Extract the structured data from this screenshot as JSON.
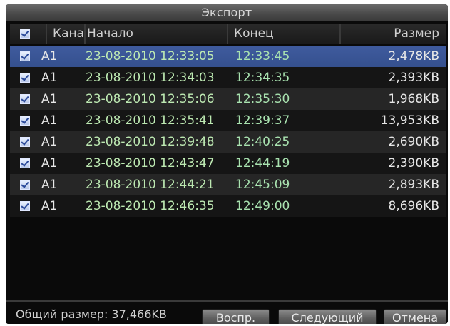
{
  "window": {
    "title": "Экспорт"
  },
  "table": {
    "headers": {
      "channel": "Канал",
      "start": "Начало",
      "end": "Конец",
      "size": "Размер"
    },
    "rows": [
      {
        "checked": true,
        "channel": "A1",
        "start": "23-08-2010 12:33:05",
        "end": "12:33:45",
        "size": "2,478KB",
        "selected": true
      },
      {
        "checked": true,
        "channel": "A1",
        "start": "23-08-2010 12:34:03",
        "end": "12:34:35",
        "size": "2,393KB"
      },
      {
        "checked": true,
        "channel": "A1",
        "start": "23-08-2010 12:35:06",
        "end": "12:35:30",
        "size": "1,968KB"
      },
      {
        "checked": true,
        "channel": "A1",
        "start": "23-08-2010 12:35:41",
        "end": "12:39:37",
        "size": "13,953KB"
      },
      {
        "checked": true,
        "channel": "A1",
        "start": "23-08-2010 12:39:48",
        "end": "12:40:25",
        "size": "2,690KB"
      },
      {
        "checked": true,
        "channel": "A1",
        "start": "23-08-2010 12:43:47",
        "end": "12:44:19",
        "size": "2,390KB"
      },
      {
        "checked": true,
        "channel": "A1",
        "start": "23-08-2010 12:44:21",
        "end": "12:45:09",
        "size": "2,893KB"
      },
      {
        "checked": true,
        "channel": "A1",
        "start": "23-08-2010 12:46:35",
        "end": "12:49:00",
        "size": "8,696KB"
      }
    ]
  },
  "footer": {
    "total_label": "Общий размер: 37,466KB",
    "play_button": "Воспр.",
    "next_button": "Следующий",
    "cancel_button": "Отмена"
  },
  "colors": {
    "selected_row": "#3f5b9e",
    "start_text": "#bde9b2",
    "end_text": "#a9e3b0"
  }
}
